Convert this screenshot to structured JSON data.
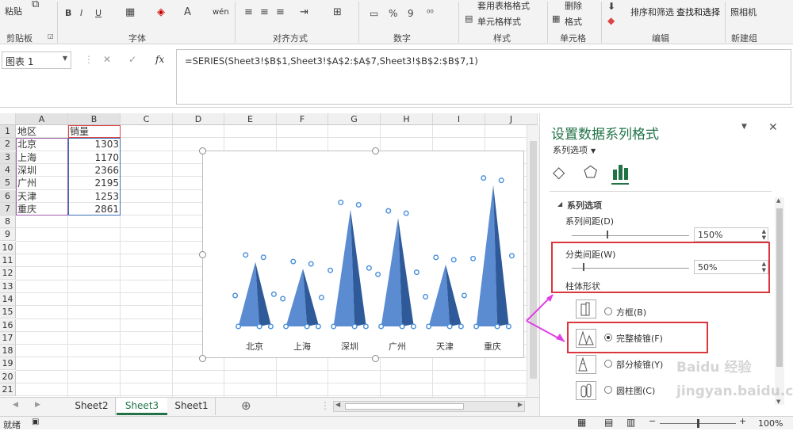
{
  "ribbon": {
    "groups": [
      "剪贴板",
      "字体",
      "对齐方式",
      "数字",
      "样式",
      "单元格",
      "编辑",
      "新建组"
    ],
    "paste_label": "粘贴",
    "font_buttons": [
      "B",
      "I",
      "U"
    ],
    "wrap_label": "wén",
    "number_buttons": [
      "%",
      "9"
    ],
    "table_format": "套用表格格式",
    "cell_style": "单元格样式",
    "delete_label": "删除",
    "format_label": "格式",
    "sort_filter": "排序和筛选",
    "find_select": "查找和选择",
    "photo_album": "照相机"
  },
  "formula_bar": {
    "name_box": "图表 1",
    "fx": "fx",
    "formula": "=SERIES(Sheet3!$B$1,Sheet3!$A$2:$A$7,Sheet3!$B$2:$B$7,1)"
  },
  "grid": {
    "columns": [
      "A",
      "B",
      "C",
      "D",
      "E",
      "F",
      "G",
      "H",
      "I",
      "J"
    ],
    "rows": [
      "1",
      "2",
      "3",
      "4",
      "5",
      "6",
      "7",
      "8",
      "9",
      "10",
      "11",
      "12",
      "13",
      "14",
      "15",
      "16",
      "17",
      "18",
      "19",
      "20",
      "21"
    ],
    "header": [
      "地区",
      "销量"
    ],
    "data": [
      [
        "北京",
        "1303"
      ],
      [
        "上海",
        "1170"
      ],
      [
        "深圳",
        "2366"
      ],
      [
        "广州",
        "2195"
      ],
      [
        "天津",
        "1253"
      ],
      [
        "重庆",
        "2861"
      ]
    ]
  },
  "chart_data": {
    "type": "bar",
    "bar_shape": "pyramid",
    "categories": [
      "北京",
      "上海",
      "深圳",
      "广州",
      "天津",
      "重庆"
    ],
    "values": [
      1303,
      1170,
      2366,
      2195,
      1253,
      2861
    ],
    "ylim": [
      0,
      3000
    ],
    "color": "#4a78bf"
  },
  "sheet_tabs": [
    "Sheet2",
    "Sheet3",
    "Sheet1"
  ],
  "active_tab": "Sheet3",
  "status": {
    "ready": "就绪",
    "zoom": "100%"
  },
  "pane": {
    "title": "设置数据系列格式",
    "dropdown": "系列选项",
    "section": "系列选项",
    "gap_depth_label": "系列间距(D)",
    "gap_depth_value": "150%",
    "gap_width_label": "分类间距(W)",
    "gap_width_value": "50%",
    "shape_label": "柱体形状",
    "shapes": [
      "方框(B)",
      "完整棱锥(F)",
      "部分棱锥(Y)",
      "圆柱图(C)"
    ],
    "selected_shape": "完整棱锥(F)"
  },
  "colors": {
    "accent": "#217346",
    "pane_title": "#217346",
    "highlight_box": "#d9363e",
    "arrow": "#e23ee6"
  },
  "watermark": "Baidu 经验 jingyan.baidu.com"
}
